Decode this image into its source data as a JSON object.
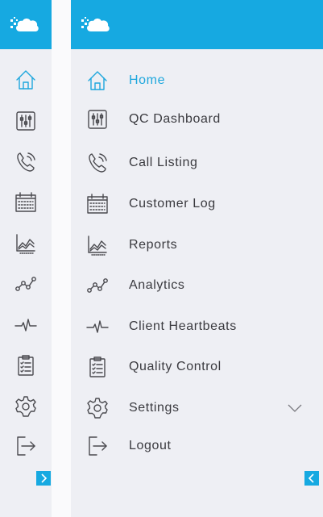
{
  "app": {
    "logo": "cloud-logo"
  },
  "colors": {
    "accent": "#16a9e1",
    "sidebar_bg": "#eeeff4",
    "text": "#3a3a3f"
  },
  "menu": {
    "items": [
      {
        "label": "Home",
        "icon": "home-icon",
        "active": true
      },
      {
        "label": "QC Dashboard",
        "icon": "sliders-icon"
      },
      {
        "label": "Call Listing",
        "icon": "phone-icon"
      },
      {
        "label": "Customer Log",
        "icon": "calendar-icon"
      },
      {
        "label": "Reports",
        "icon": "line-chart-icon"
      },
      {
        "label": "Analytics",
        "icon": "analytics-icon"
      },
      {
        "label": "Client Heartbeats",
        "icon": "heartbeat-icon"
      },
      {
        "label": "Quality Control",
        "icon": "clipboard-icon"
      },
      {
        "label": "Settings",
        "icon": "gear-icon",
        "has_submenu": true
      },
      {
        "label": "Logout",
        "icon": "logout-icon"
      }
    ]
  },
  "toggles": {
    "expand": "chevron-right-icon",
    "collapse": "chevron-left-icon"
  }
}
